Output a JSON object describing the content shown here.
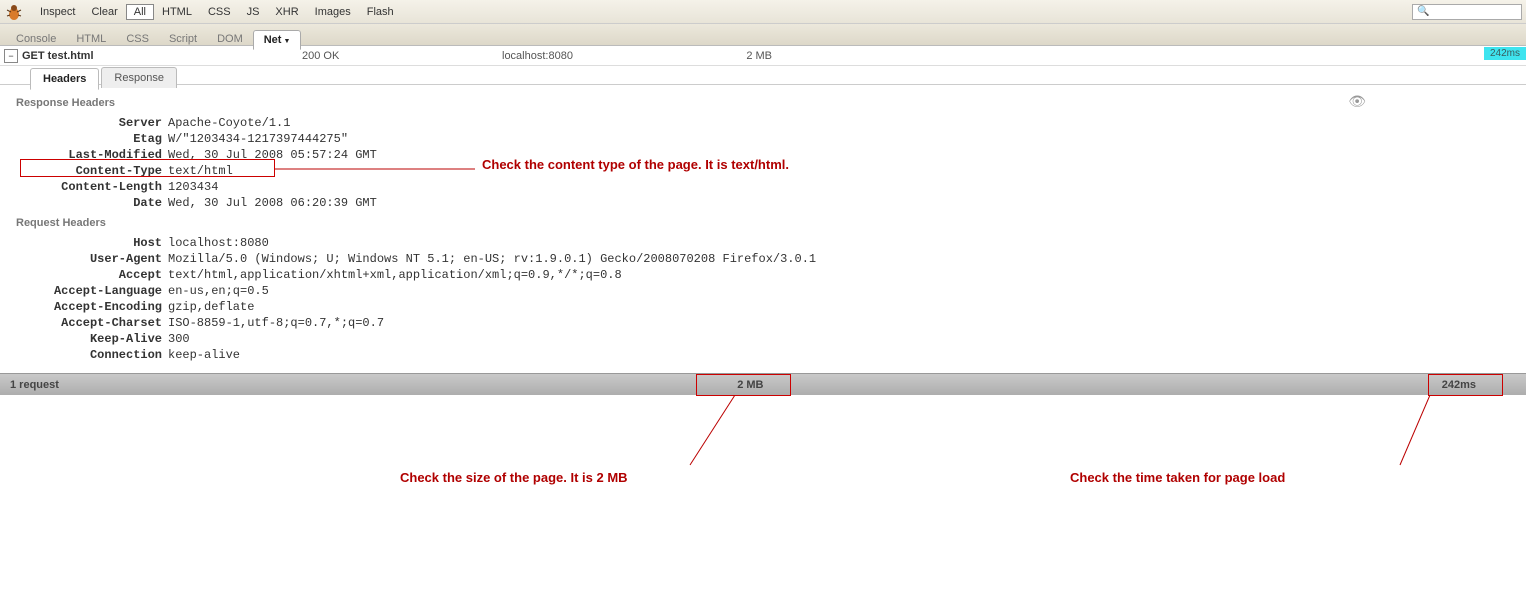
{
  "toolbar": {
    "inspect": "Inspect",
    "clear": "Clear",
    "filters": [
      "All",
      "HTML",
      "CSS",
      "JS",
      "XHR",
      "Images",
      "Flash"
    ],
    "active_filter": "All"
  },
  "panel_tabs": {
    "items": [
      "Console",
      "HTML",
      "CSS",
      "Script",
      "DOM",
      "Net"
    ],
    "active": "Net"
  },
  "request": {
    "method_name": "GET test.html",
    "status": "200 OK",
    "domain": "localhost:8080",
    "size": "2 MB",
    "time": "242ms"
  },
  "sub_tabs": {
    "items": [
      "Headers",
      "Response"
    ],
    "active": "Headers"
  },
  "response_headers_title": "Response Headers",
  "response_headers": [
    {
      "k": "Server",
      "v": "Apache-Coyote/1.1"
    },
    {
      "k": "Etag",
      "v": "W/\"1203434-1217397444275\""
    },
    {
      "k": "Last-Modified",
      "v": "Wed, 30 Jul 2008 05:57:24 GMT"
    },
    {
      "k": "Content-Type",
      "v": "text/html"
    },
    {
      "k": "Content-Length",
      "v": "1203434"
    },
    {
      "k": "Date",
      "v": "Wed, 30 Jul 2008 06:20:39 GMT"
    }
  ],
  "request_headers_title": "Request Headers",
  "request_headers": [
    {
      "k": "Host",
      "v": "localhost:8080"
    },
    {
      "k": "User-Agent",
      "v": "Mozilla/5.0 (Windows; U; Windows NT 5.1; en-US; rv:1.9.0.1) Gecko/2008070208 Firefox/3.0.1"
    },
    {
      "k": "Accept",
      "v": "text/html,application/xhtml+xml,application/xml;q=0.9,*/*;q=0.8"
    },
    {
      "k": "Accept-Language",
      "v": "en-us,en;q=0.5"
    },
    {
      "k": "Accept-Encoding",
      "v": "gzip,deflate"
    },
    {
      "k": "Accept-Charset",
      "v": "ISO-8859-1,utf-8;q=0.7,*;q=0.7"
    },
    {
      "k": "Keep-Alive",
      "v": "300"
    },
    {
      "k": "Connection",
      "v": "keep-alive"
    }
  ],
  "status_bar": {
    "requests": "1 request",
    "size": "2 MB",
    "time": "242ms"
  },
  "annotations": {
    "content_type": "Check the content type of the page. It is text/html.",
    "size": "Check the size of the page. It is 2 MB",
    "time": "Check the time taken for page load"
  }
}
